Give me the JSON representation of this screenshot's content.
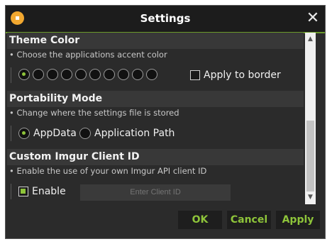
{
  "window": {
    "title": "Settings",
    "close_glyph": "✕"
  },
  "sections": {
    "theme": {
      "title": "Theme Color",
      "description": "• Choose the applications accent color",
      "apply_border_label": "Apply to border",
      "selected_swatch_index": 0,
      "swatch_count": 10
    },
    "portability": {
      "title": "Portability Mode",
      "description": "• Change where the settings file is stored",
      "options": [
        "AppData",
        "Application Path"
      ],
      "selected": "AppData"
    },
    "imgur": {
      "title": "Custom Imgur Client ID",
      "description": "• Enable the use of your own Imgur API client ID",
      "enable_label": "Enable",
      "enable_checked": true,
      "client_id_value": "",
      "client_id_placeholder": "Enter Client ID"
    }
  },
  "scrollbar": {
    "up_glyph": "▲",
    "down_glyph": "▼"
  },
  "buttons": {
    "ok": "OK",
    "cancel": "Cancel",
    "apply": "Apply"
  },
  "colors": {
    "accent": "#8ec43a",
    "background": "#2b2b2b",
    "header": "#383838",
    "titlebar": "#1c1c1c"
  }
}
